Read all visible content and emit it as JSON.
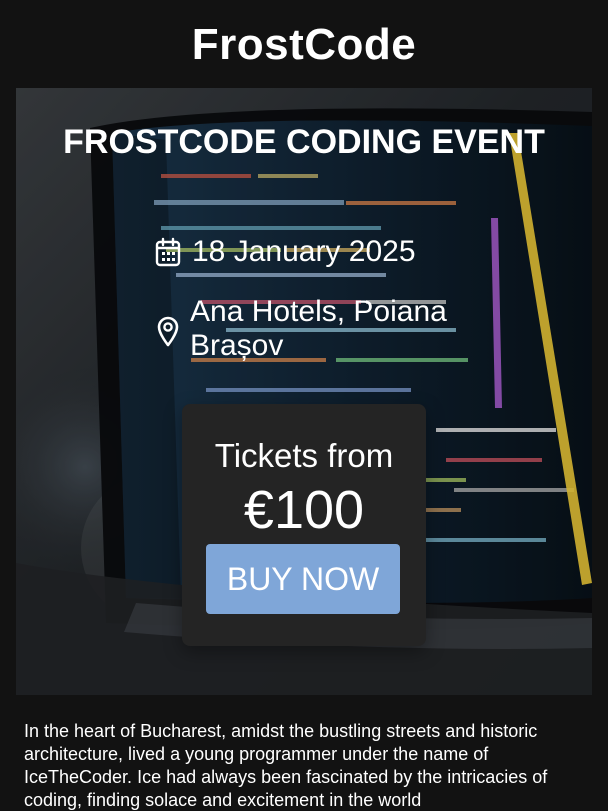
{
  "site": {
    "title": "FrostCode"
  },
  "hero": {
    "event_title": "FROSTCODE CODING EVENT",
    "date_icon": "calendar-icon",
    "date": "18 January 2025",
    "location_icon": "location-pin-icon",
    "location": "Ana Hotels, Poiana Brașov"
  },
  "tickets": {
    "label": "Tickets from",
    "price": "€100",
    "button_label": "BUY NOW"
  },
  "story": {
    "text": "In the heart of Bucharest, amidst the bustling streets and historic architecture, lived a young programmer under the name of IceTheCoder. Ice had always been fascinated by the intricacies of coding, finding solace and excitement in the world"
  },
  "colors": {
    "page_background": "#121212",
    "card_background": "#242424",
    "button_background": "#7fa6d8",
    "text": "#ffffff"
  }
}
